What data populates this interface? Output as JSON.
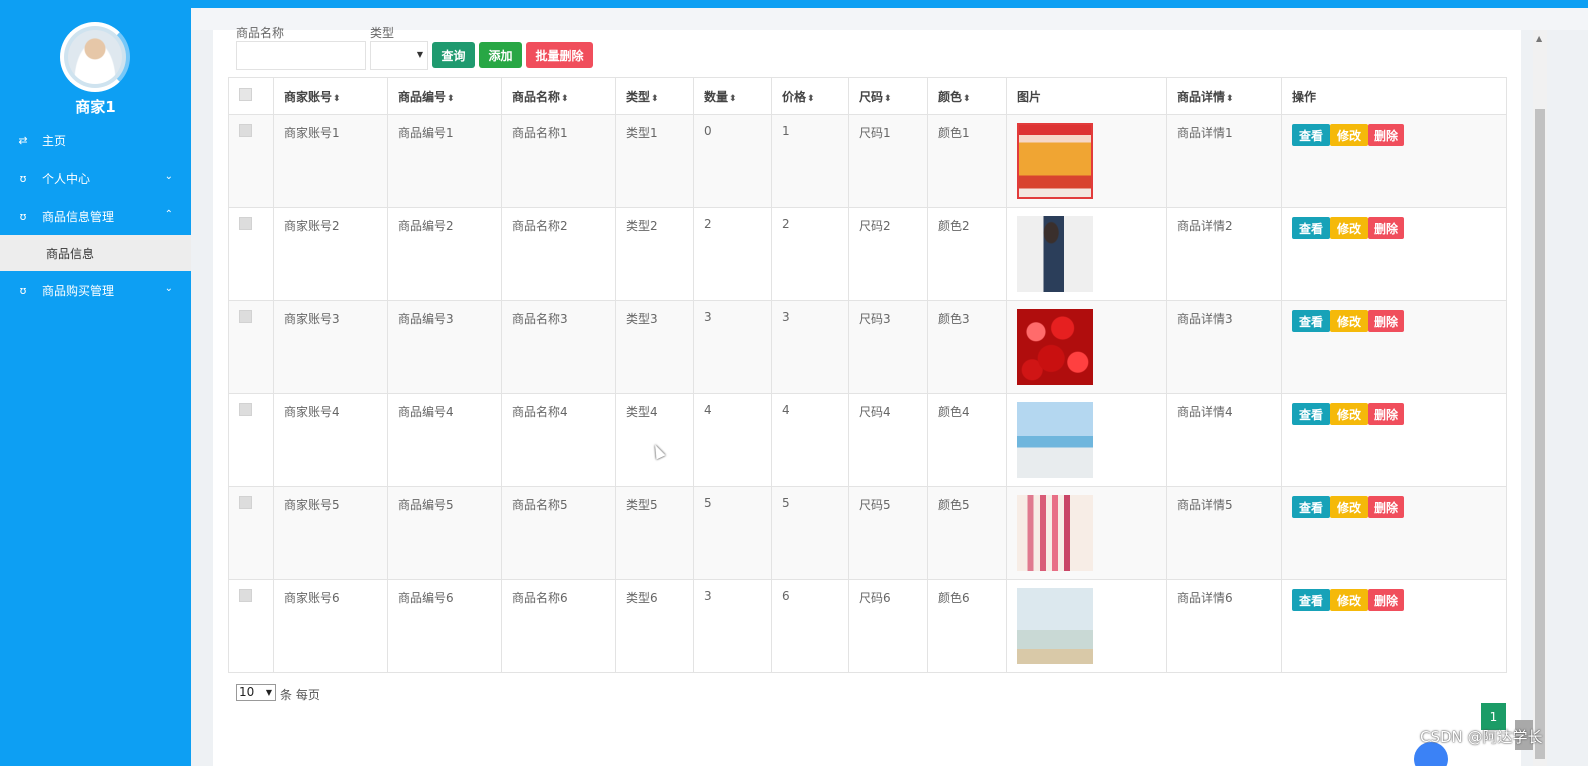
{
  "sidebar": {
    "username": "商家1",
    "items": [
      {
        "label": "主页",
        "icon": "home-icon",
        "expand": ""
      },
      {
        "label": "个人中心",
        "icon": "user-icon",
        "expand": "⌄"
      },
      {
        "label": "商品信息管理",
        "icon": "goods-icon",
        "expand": "⌃"
      },
      {
        "label": "商品信息",
        "icon": "",
        "expand": ""
      },
      {
        "label": "商品购买管理",
        "icon": "cart-icon",
        "expand": "⌄"
      }
    ]
  },
  "search": {
    "name_label": "商品名称",
    "type_label": "类型",
    "query_label": "查询",
    "add_label": "添加",
    "batch_delete_label": "批量删除"
  },
  "table": {
    "headers": [
      "商家账号",
      "商品编号",
      "商品名称",
      "类型",
      "数量",
      "价格",
      "尺码",
      "颜色",
      "图片",
      "商品详情",
      "操作"
    ],
    "actions": {
      "view": "查看",
      "edit": "修改",
      "delete": "删除"
    },
    "rows": [
      {
        "account": "商家账号1",
        "code": "商品编号1",
        "name": "商品名称1",
        "type": "类型1",
        "qty": "0",
        "price": "1",
        "size": "尺码1",
        "color": "颜色1",
        "image": "snack-box-image",
        "detail": "商品详情1"
      },
      {
        "account": "商家账号2",
        "code": "商品编号2",
        "name": "商品名称2",
        "type": "类型2",
        "qty": "2",
        "price": "2",
        "size": "尺码2",
        "color": "颜色2",
        "image": "fashion-model-image",
        "detail": "商品详情2"
      },
      {
        "account": "商家账号3",
        "code": "商品编号3",
        "name": "商品名称3",
        "type": "类型3",
        "qty": "3",
        "price": "3",
        "size": "尺码3",
        "color": "颜色3",
        "image": "cherries-image",
        "detail": "商品详情3"
      },
      {
        "account": "商家账号4",
        "code": "商品编号4",
        "name": "商品名称4",
        "type": "类型4",
        "qty": "4",
        "price": "4",
        "size": "尺码4",
        "color": "颜色4",
        "image": "beach-dress-image",
        "detail": "商品详情4"
      },
      {
        "account": "商家账号5",
        "code": "商品编号5",
        "name": "商品名称5",
        "type": "类型5",
        "qty": "5",
        "price": "5",
        "size": "尺码5",
        "color": "颜色5",
        "image": "lipsticks-image",
        "detail": "商品详情5"
      },
      {
        "account": "商家账号6",
        "code": "商品编号6",
        "name": "商品名称6",
        "type": "类型6",
        "qty": "3",
        "price": "6",
        "size": "尺码6",
        "color": "颜色6",
        "image": "milk-image",
        "detail": "商品详情6"
      }
    ]
  },
  "pagination": {
    "page_size": "10",
    "page_size_label": "条 每页",
    "current_page": "1"
  },
  "watermark": "CSDN @阿达学长",
  "colors": {
    "sidebar_bg": "#0d9ff3",
    "query_btn": "#1f9a6f",
    "add_btn": "#28a745",
    "delete_btn": "#f04e5c",
    "view_btn": "#17a2b8",
    "edit_btn": "#f5b90a",
    "page_active": "#1b9c67"
  }
}
